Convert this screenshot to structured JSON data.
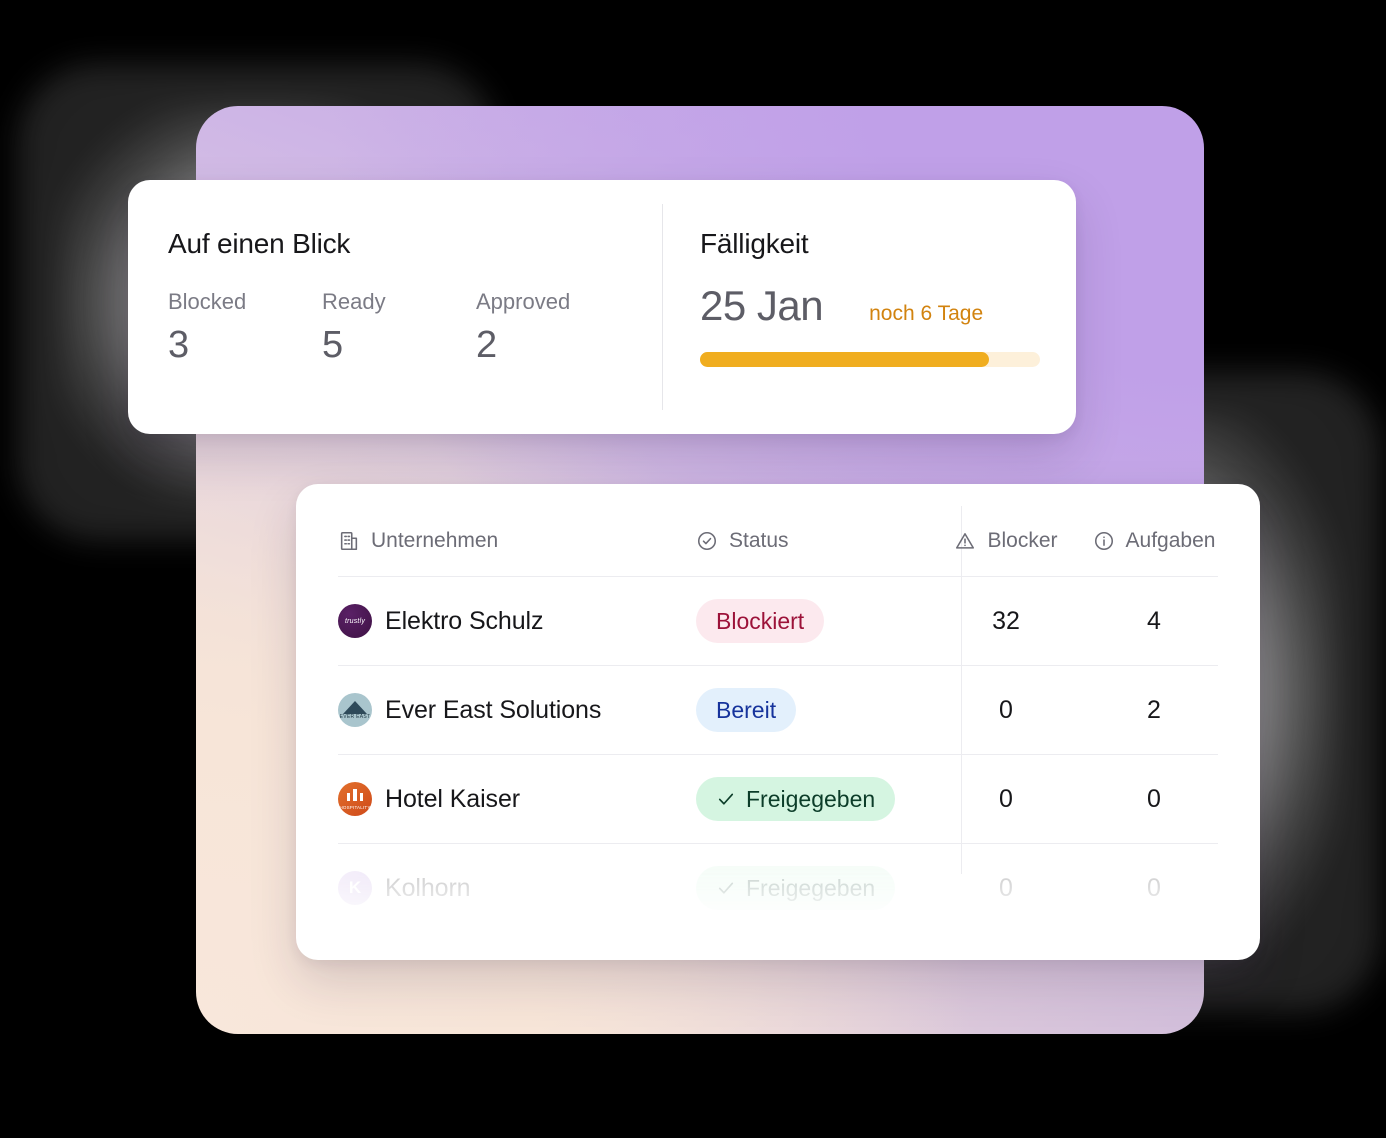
{
  "summary_card": {
    "heading": "Auf einen Blick",
    "stats": [
      {
        "label": "Blocked",
        "value": "3"
      },
      {
        "label": "Ready",
        "value": "5"
      },
      {
        "label": "Approved",
        "value": "2"
      }
    ]
  },
  "due_card": {
    "heading": "Fälligkeit",
    "date": "25 Jan",
    "remaining": "noch 6 Tage",
    "progress_percent": 85,
    "progress_fill_color": "#f0ad1f",
    "progress_track_color": "#fdf0da",
    "remaining_color": "#d2830f"
  },
  "table": {
    "columns": [
      {
        "label": "Unternehmen",
        "icon": "building-icon"
      },
      {
        "label": "Status",
        "icon": "check-circle-icon"
      },
      {
        "label": "Blocker",
        "icon": "warning-triangle-icon"
      },
      {
        "label": "Aufgaben",
        "icon": "info-circle-icon"
      }
    ],
    "rows": [
      {
        "company": "Elektro Schulz",
        "avatar": "trustly-logo",
        "avatar_text": "trustly",
        "status": "Blockiert",
        "status_kind": "blocked",
        "status_has_check": false,
        "blocker": "32",
        "tasks": "4"
      },
      {
        "company": "Ever East Solutions",
        "avatar": "ever-east-logo",
        "avatar_text": "EVER EAST",
        "status": "Bereit",
        "status_kind": "ready",
        "status_has_check": false,
        "blocker": "0",
        "tasks": "2"
      },
      {
        "company": "Hotel Kaiser",
        "avatar": "hospitality-hotels-logo",
        "avatar_text": "HOSPITALITY",
        "status": "Freigegeben",
        "status_kind": "approved",
        "status_has_check": true,
        "blocker": "0",
        "tasks": "0"
      },
      {
        "company": "Kolhorn",
        "avatar": "kolhorn-logo",
        "avatar_text": "K",
        "status": "Freigegeben",
        "status_kind": "approved",
        "status_has_check": true,
        "blocker": "0",
        "tasks": "0"
      }
    ]
  },
  "theme": {
    "gradient_purple": "#c0a0e8",
    "gradient_peach": "#f8e8dd",
    "gradient_mauve": "#d2bedb",
    "card_background": "#ffffff",
    "page_background": "#000000",
    "badge_blocked_bg": "#fce9ee",
    "badge_blocked_fg": "#9c1239",
    "badge_ready_bg": "#e3f0fc",
    "badge_ready_fg": "#16339c",
    "badge_approved_bg": "#d5f5e1",
    "badge_approved_fg": "#0c3d29"
  }
}
